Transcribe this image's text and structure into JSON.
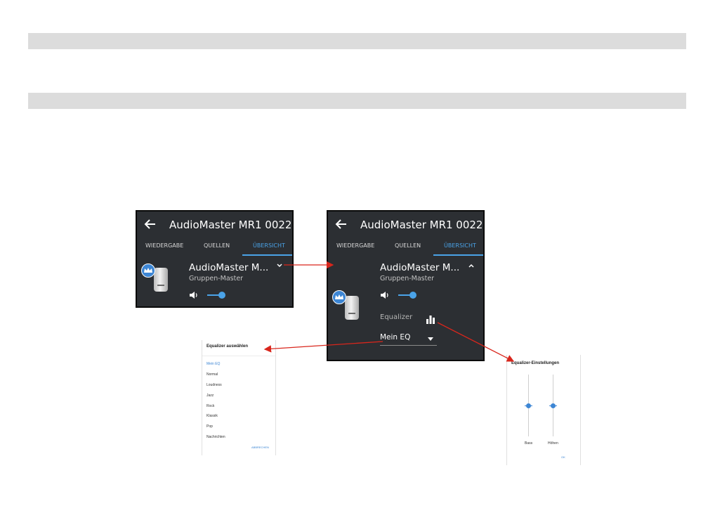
{
  "app": {
    "title": "AudioMaster MR1 0022...",
    "tabs": [
      "WIEDERGABE",
      "QUELLEN",
      "ÜBERSICHT"
    ],
    "active_tab": "ÜBERSICHT",
    "device_name": "AudioMaster M...",
    "device_role": "Gruppen-Master",
    "equalizer_label": "Equalizer",
    "equalizer_selected": "Mein EQ"
  },
  "colors": {
    "accent": "#4aa3e8",
    "panel_bg": "#2c2f33",
    "arrow": "#d9261c"
  },
  "icons": {
    "back": "arrow-left-icon",
    "master": "crown-icon",
    "volume": "speaker-volume-icon",
    "equalizer": "equalizer-bars-icon",
    "expand": "chevron-down-icon",
    "collapse": "chevron-up-icon",
    "dropdown": "caret-down-icon"
  },
  "volume_level": 0.55,
  "dialog_eq_select": {
    "title": "Equalizer auswählen",
    "options": [
      "Mein EQ",
      "Normal",
      "Loudness",
      "Jazz",
      "Rock",
      "Klassik",
      "Pop",
      "Nachrichten"
    ],
    "selected": "Mein EQ",
    "cancel_label": "ABBRECHEN"
  },
  "dialog_eq_settings": {
    "title": "Equalizer-Einstellungen",
    "bass_label": "Bass",
    "treble_label": "Höhen",
    "bass_level": 0.5,
    "treble_level": 0.5,
    "ok_label": "OK"
  }
}
